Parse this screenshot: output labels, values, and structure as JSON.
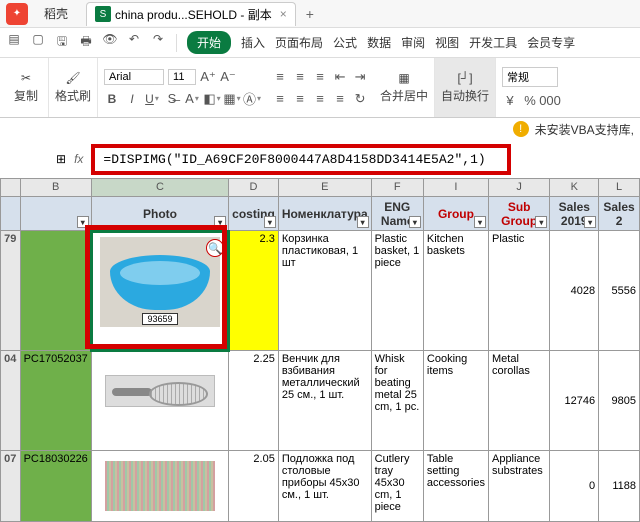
{
  "titlebar": {
    "app": "稻壳",
    "doc": "china produ...SEHOLD - 副本"
  },
  "menu": {
    "start": "开始",
    "items": [
      "插入",
      "页面布局",
      "公式",
      "数据",
      "审阅",
      "视图",
      "开发工具",
      "会员专享"
    ]
  },
  "toolbar": {
    "copy": "复制",
    "format": "格式刷",
    "font": "Arial",
    "size": "11",
    "merge": "合并居中",
    "wrap": "自动换行",
    "general": "常规"
  },
  "warning": "未安装VBA支持库,",
  "formula": "=DISPIMG(\"ID_A69CF20F8000447A8D4158DD3414E5A2\",1)",
  "cols": [
    "B",
    "C",
    "D",
    "E",
    "F",
    "I",
    "J",
    "K",
    "L"
  ],
  "headers": [
    "",
    "Photo",
    "costing",
    "Номенклатура",
    "ENG Name",
    "Group",
    "Sub Group",
    "Sales 2019",
    "Sales 2"
  ],
  "rows": [
    {
      "rh": "79",
      "b": "",
      "cost": "2.3",
      "nom": "Корзинка пластиковая, 1 шт",
      "eng": "Plastic basket, 1 piece",
      "grp": "Kitchen baskets",
      "sub": "Plastic",
      "s19": "4028",
      "s2": "5556",
      "img": "bowl",
      "imglabel": "93659"
    },
    {
      "rh": "04",
      "b": "PC17052037",
      "cost": "2.25",
      "nom": "Венчик для взбивания металлический 25 см., 1 шт.",
      "eng": "Whisk for beating metal 25 cm, 1 pc.",
      "grp": "Cooking items",
      "sub": "Metal corollas",
      "s19": "12746",
      "s2": "9805",
      "img": "whisk"
    },
    {
      "rh": "07",
      "b": "PC18030226",
      "cost": "2.05",
      "nom": "Подложка под столовые приборы 45х30 см., 1 шт.",
      "eng": "Cutlery tray 45x30 cm, 1 piece",
      "grp": "Table setting accessories",
      "sub": "Appliance substrates",
      "s19": "0",
      "s2": "1188",
      "img": "fabric"
    }
  ]
}
